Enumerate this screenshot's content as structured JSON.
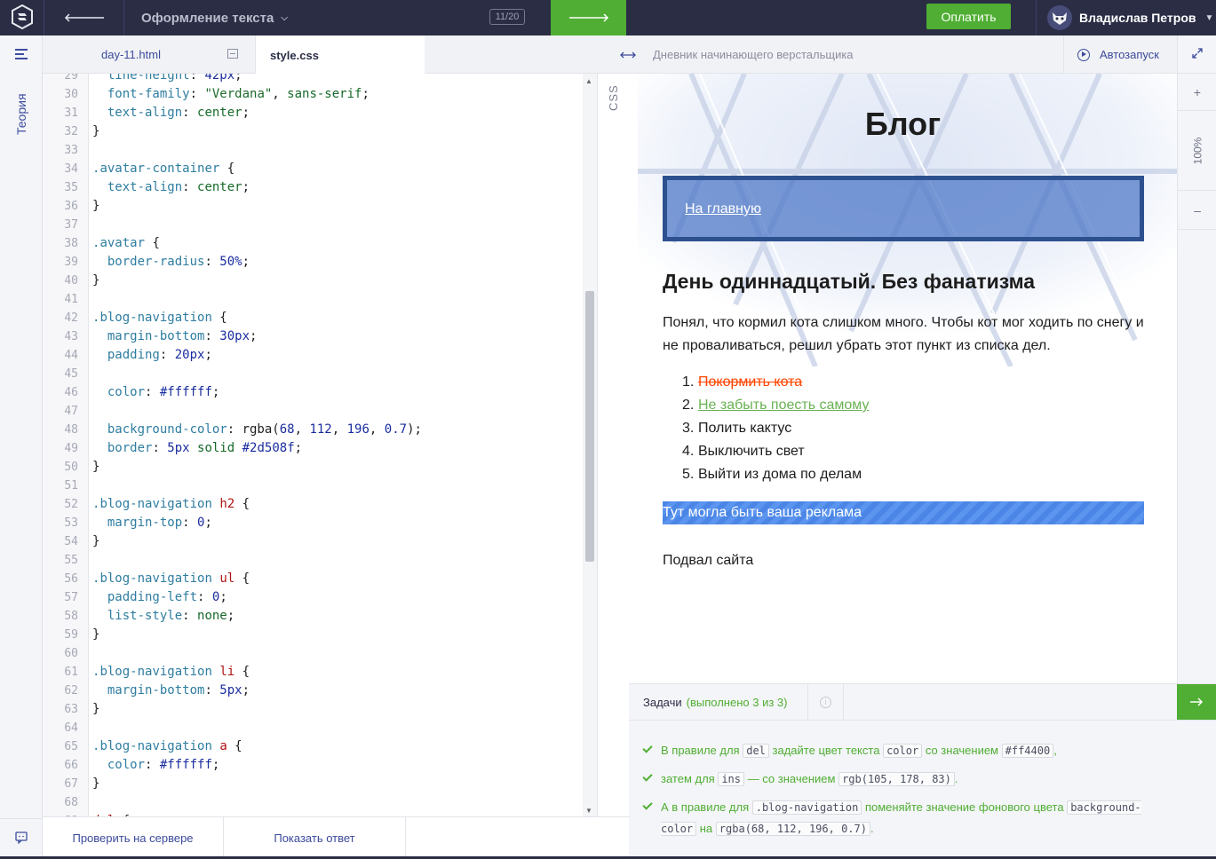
{
  "topbar": {
    "title": "Оформление текста",
    "progress": "11/20",
    "pay_label": "Оплатить",
    "user_name": "Владислав Петров"
  },
  "rail": {
    "theory_label": "Теория"
  },
  "editor": {
    "tabs": [
      {
        "label": "day-11.html"
      },
      {
        "label": "style.css"
      }
    ],
    "side_label": "CSS",
    "check_button": "Проверить на сервере",
    "answer_button": "Показать ответ"
  },
  "preview": {
    "title": "Дневник начинающего верстальщика",
    "autorun_label": "Автозапуск",
    "zoom": "100%",
    "h1": "Блог",
    "nav_link": "На главную",
    "h2": "День одиннадцатый. Без фанатизма",
    "paragraph": "Понял, что кормил кота слишком много. Чтобы кот мог ходить по снегу и не проваливаться, решил убрать этот пункт из списка дел.",
    "list": [
      {
        "num": "1.",
        "text": "Покормить кота"
      },
      {
        "num": "2.",
        "text": "Не забыть поесть самому"
      },
      {
        "num": "3.",
        "text": "Полить кактус"
      },
      {
        "num": "4.",
        "text": "Выключить свет"
      },
      {
        "num": "5.",
        "text": "Выйти из дома по делам"
      }
    ],
    "ad": "Тут могла быть ваша реклама",
    "footer": "Подвал сайта"
  },
  "tasks": {
    "tab_label": "Задачи",
    "done_label": "(выполнено 3 из 3)",
    "items": [
      {
        "p1": "В правиле для",
        "c1": "del",
        "p2": "задайте цвет текста",
        "c2": "color",
        "p3": "со значением",
        "c3": "#ff4400",
        "p4": ","
      },
      {
        "p1": "затем для",
        "c1": "ins",
        "p2": "— со значением",
        "c2": "rgb(105, 178, 83)",
        "p3": "."
      },
      {
        "p1": "А в правиле для",
        "c1": ".blog-navigation",
        "p2": "поменяйте значение фонового цвета",
        "c2": "background-color",
        "p3": "на",
        "c3": "rgba(68, 112, 196, 0.7)",
        "p4": "."
      }
    ]
  },
  "colors": {
    "accent_green": "#4fae33",
    "topbar_bg": "#2a2d44",
    "link_blue": "#3c4a9c"
  }
}
